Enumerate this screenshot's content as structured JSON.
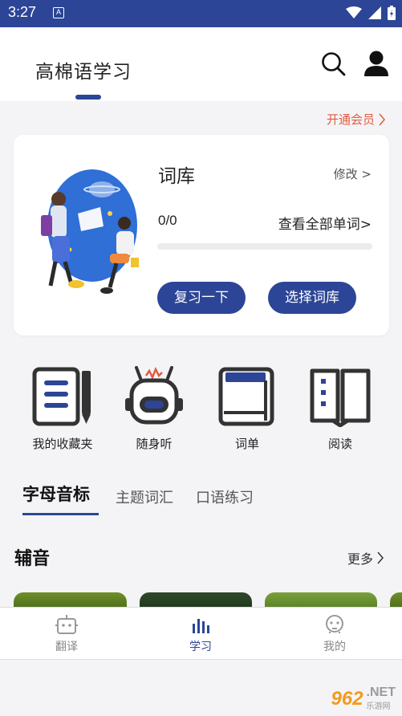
{
  "status_bar": {
    "time": "3:27",
    "notification_glyph": "A"
  },
  "app_bar": {
    "title": "高棉语学习"
  },
  "membership": {
    "label": "开通会员"
  },
  "vocab_card": {
    "title": "词库",
    "edit_label": "修改 >",
    "progress_text": "0/0",
    "progress_fraction": 0,
    "view_all_label": "查看全部单词>",
    "review_button": "复习一下",
    "choose_button": "选择词库"
  },
  "features": [
    {
      "label": "我的收藏夹",
      "icon": "notebook-pencil-icon"
    },
    {
      "label": "随身听",
      "icon": "robot-icon"
    },
    {
      "label": "词单",
      "icon": "book-icon"
    },
    {
      "label": "阅读",
      "icon": "open-book-icon"
    }
  ],
  "tabs": [
    {
      "label": "字母音标",
      "active": true
    },
    {
      "label": "主题词汇",
      "active": false
    },
    {
      "label": "口语练习",
      "active": false
    }
  ],
  "section": {
    "title": "辅音",
    "more_label": "更多"
  },
  "bottom_nav": [
    {
      "label": "翻译",
      "icon": "robot-icon",
      "active": false
    },
    {
      "label": "学习",
      "icon": "bar-chart-icon",
      "active": true
    },
    {
      "label": "我的",
      "icon": "face-icon",
      "active": false
    }
  ],
  "watermark": {
    "number": "962",
    "domain": ".NET",
    "subtitle": "乐游网"
  },
  "colors": {
    "primary": "#2c4596",
    "accent": "#e25b3e",
    "background": "#f4f4f6"
  }
}
